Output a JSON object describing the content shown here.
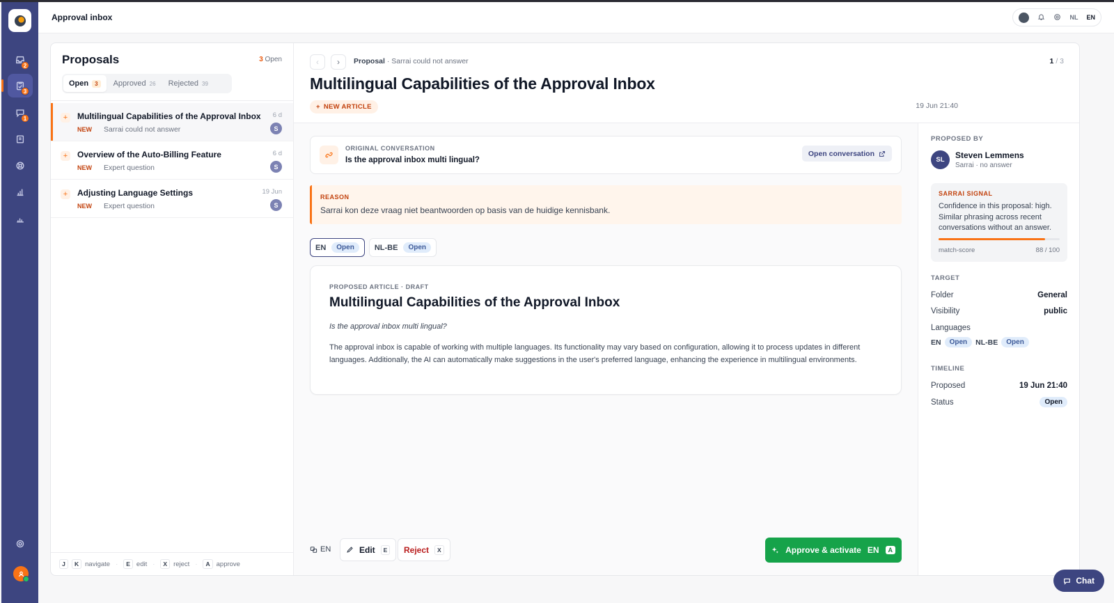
{
  "topbar": {
    "title": "Approval inbox",
    "lang_nl": "NL",
    "lang_en": "EN"
  },
  "rail": {
    "badges": {
      "inbox": "2",
      "proposals": "3",
      "conversations": "1"
    }
  },
  "list": {
    "title": "Proposals",
    "open_count": "3",
    "open_label": "Open",
    "tabs": [
      {
        "label": "Open",
        "count": "3"
      },
      {
        "label": "Approved",
        "count": "26"
      },
      {
        "label": "Rejected",
        "count": "39"
      }
    ],
    "items": [
      {
        "title": "Multilingual Capabilities of the Approval Inbox",
        "tag": "NEW",
        "sub": "Sarrai could not answer",
        "age": "6 d",
        "avatar": "S"
      },
      {
        "title": "Overview of the Auto-Billing Feature",
        "tag": "NEW",
        "sub": "Expert question",
        "age": "6 d",
        "avatar": "S"
      },
      {
        "title": "Adjusting Language Settings",
        "tag": "NEW",
        "sub": "Expert question",
        "age": "19 Jun",
        "avatar": "S"
      }
    ],
    "shortcuts": {
      "j": "J",
      "k": "K",
      "navigate": "navigate",
      "e": "E",
      "edit": "edit",
      "x": "X",
      "reject": "reject",
      "a": "A",
      "approve": "approve"
    }
  },
  "detail": {
    "crumb_bold": "Proposal",
    "crumb_rest": "· Sarrai could not answer",
    "pager_current": "1",
    "pager_total": "/ 3",
    "title": "Multilingual Capabilities of the Approval Inbox",
    "badge": "NEW ARTICLE",
    "date": "19 Jun 21:40",
    "original": {
      "label": "ORIGINAL CONVERSATION",
      "question": "Is the approval inbox multi lingual?",
      "button": "Open conversation"
    },
    "reason": {
      "label": "REASON",
      "text": "Sarrai kon deze vraag niet beantwoorden op basis van de huidige kennisbank."
    },
    "lang_tabs": [
      {
        "code": "EN",
        "status": "Open"
      },
      {
        "code": "NL-BE",
        "status": "Open"
      }
    ],
    "article": {
      "label": "PROPOSED ARTICLE · DRAFT",
      "title": "Multilingual Capabilities of the Approval Inbox",
      "question": "Is the approval inbox multi lingual?",
      "body": "The approval inbox is capable of working with multiple languages. Its functionality may vary based on configuration, allowing it to process updates in different languages. Additionally, the AI can automatically make suggestions in the user's preferred language, enhancing the experience in multilingual environments."
    },
    "footer": {
      "lang": "EN",
      "edit": "Edit",
      "edit_key": "E",
      "reject": "Reject",
      "reject_key": "X",
      "approve": "Approve & activate",
      "approve_lang": "EN",
      "approve_key": "A"
    }
  },
  "side": {
    "proposed_by_label": "PROPOSED BY",
    "initials": "SL",
    "name": "Steven Lemmens",
    "meta": "Sarrai · no answer",
    "signal": {
      "label": "SARRAI SIGNAL",
      "text": "Confidence in this proposal: high. Similar phrasing across recent conversations without an answer.",
      "metric_label": "match-score",
      "metric_value": "88 / 100",
      "score": 88
    },
    "target_label": "TARGET",
    "folder_label": "Folder",
    "folder": "General",
    "visibility_label": "Visibility",
    "visibility": "public",
    "languages_label": "Languages",
    "languages": [
      {
        "code": "EN",
        "status": "Open"
      },
      {
        "code": "NL-BE",
        "status": "Open"
      }
    ],
    "timeline_label": "TIMELINE",
    "proposed_label": "Proposed",
    "proposed": "19 Jun 21:40",
    "status_label": "Status",
    "status": "Open"
  },
  "chat": {
    "label": "Chat"
  },
  "colors": {
    "accent": "#f97316",
    "brand": "#3d4580",
    "approve": "#16a34a",
    "pill_bg": "#e0ecfb"
  }
}
